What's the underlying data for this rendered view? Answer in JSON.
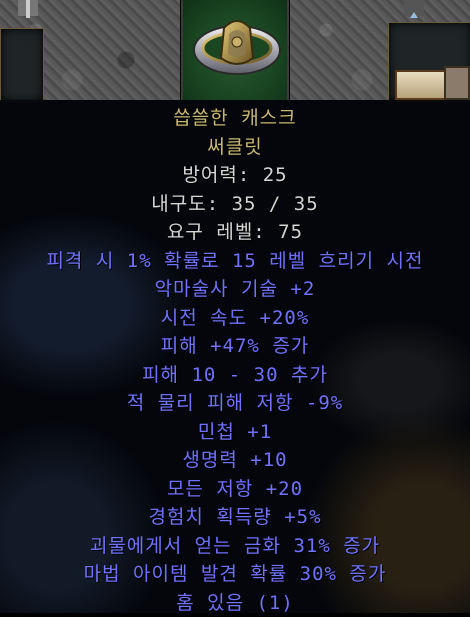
{
  "colors": {
    "unique_gold": "#c9b873",
    "base_white": "#d6d6d6",
    "magic_blue": "#6f72ff",
    "slot_green": "#1a4622"
  },
  "equipment_slot": {
    "icon": "belt-icon"
  },
  "item": {
    "name": "씁쓸한 캐스크",
    "base_type": "써클릿",
    "defense": "방어력: 25",
    "durability": "내구도: 35 / 35",
    "required_level": "요구 레벨: 75",
    "mods": [
      "피격 시 1% 확률로 15 레벨 흐리기 시전",
      "악마술사 기술 +2",
      "시전 속도 +20%",
      "피해 +47% 증가",
      "피해 10 - 30 추가",
      "적 물리 피해 저항 -9%",
      "민첩 +1",
      "생명력 +10",
      "모든 저항 +20",
      "경험치 획득량 +5%",
      "괴물에게서 얻는 금화 31% 증가",
      "마법 아이템 발견 확률 30% 증가",
      "홈 있음 (1)"
    ]
  }
}
